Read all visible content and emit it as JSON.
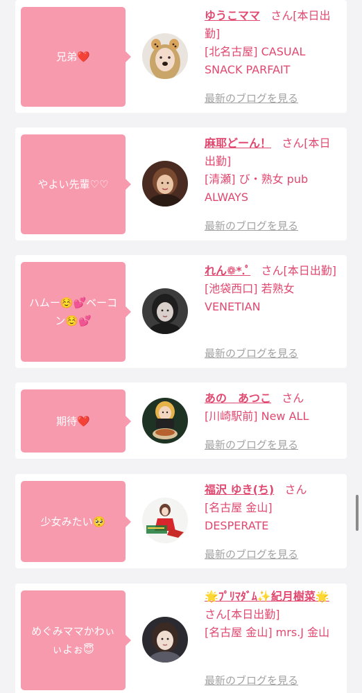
{
  "honorific": "さん",
  "blog_link_label": "最新のブログを見る",
  "posts": [
    {
      "comment": "兄弟",
      "comment_emoji": "❤️",
      "name": "ゆうこママ",
      "status": "[本日出勤]",
      "area": "[北名古屋]",
      "shop": "CASUAL SNACK PARFAIT",
      "avatar_icon": "woman-dog-filter-photo"
    },
    {
      "comment": "やよい先輩♡♡",
      "comment_emoji": "",
      "name": "麻耶どーん！",
      "status": "[本日出勤]",
      "area": "[清瀬]",
      "shop": "び・熟女 pub ALWAYS",
      "avatar_icon": "woman-photo"
    },
    {
      "comment": "ハムー☺️💕ベーコン☺️💕",
      "comment_emoji": "",
      "name": "れん❁*.ﾟ",
      "status": "[本日出勤]",
      "area": "[池袋西口]",
      "shop": "若熟女 VENETIAN",
      "avatar_icon": "woman-photo"
    },
    {
      "comment": "期待",
      "comment_emoji": "❤️",
      "name": "あの　あつこ",
      "status": "",
      "area": "[川崎駅前]",
      "shop": "New ALL",
      "avatar_icon": "woman-ramen-photo"
    },
    {
      "comment": "少女みたい🥺",
      "comment_emoji": "",
      "name": "福沢 ゆき(ち)",
      "status": "",
      "area": "[名古屋 金山]",
      "shop": "DESPERATE",
      "avatar_icon": "christmas-photo"
    },
    {
      "comment": "めぐみママかわぃぃよぉ😇",
      "comment_emoji": "",
      "name": "🌟ﾌﾟﾘﾏﾀﾞﾑ✨紀月樹菜🌟",
      "status": "[本日出勤]",
      "area": "[名古屋 金山]",
      "shop": "mrs.J 金山",
      "avatar_icon": "woman-photo"
    }
  ],
  "colors": {
    "accent": "#e0486f",
    "bubble": "#f89aae",
    "link_gray": "#a2a2a2",
    "background": "#f3f3f5"
  }
}
